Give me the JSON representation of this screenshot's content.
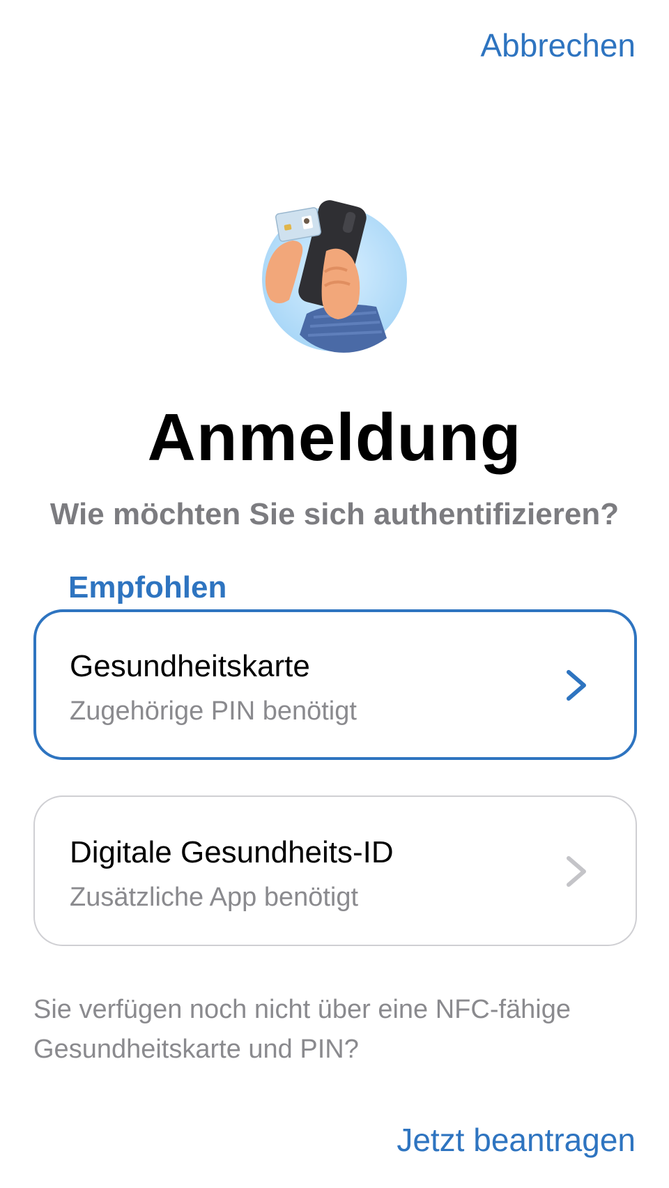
{
  "header": {
    "cancel_label": "Abbrechen"
  },
  "hero": {
    "icon": "hand-holding-phone-and-health-card-illustration"
  },
  "title": "Anmeldung",
  "subtitle": "Wie möchten Sie sich authentifizieren?",
  "section_label": "Empfohlen",
  "options": [
    {
      "title": "Gesundheitskarte",
      "subtitle": "Zugehörige PIN benötigt",
      "icon": "chevron-right-icon",
      "state": "highlighted"
    },
    {
      "title": "Digitale Gesundheits-ID",
      "subtitle": "Zusätzliche App benötigt",
      "icon": "chevron-right-icon",
      "state": "default"
    }
  ],
  "info_text": "Sie verfügen noch nicht über eine NFC-fähige Gesundheitskarte und PIN?",
  "apply_label": "Jetzt beantragen",
  "colors": {
    "accent": "#2e74c0",
    "secondary_text": "#8a8a8e",
    "title_text": "#000000",
    "border_default": "#cfcfd3"
  }
}
